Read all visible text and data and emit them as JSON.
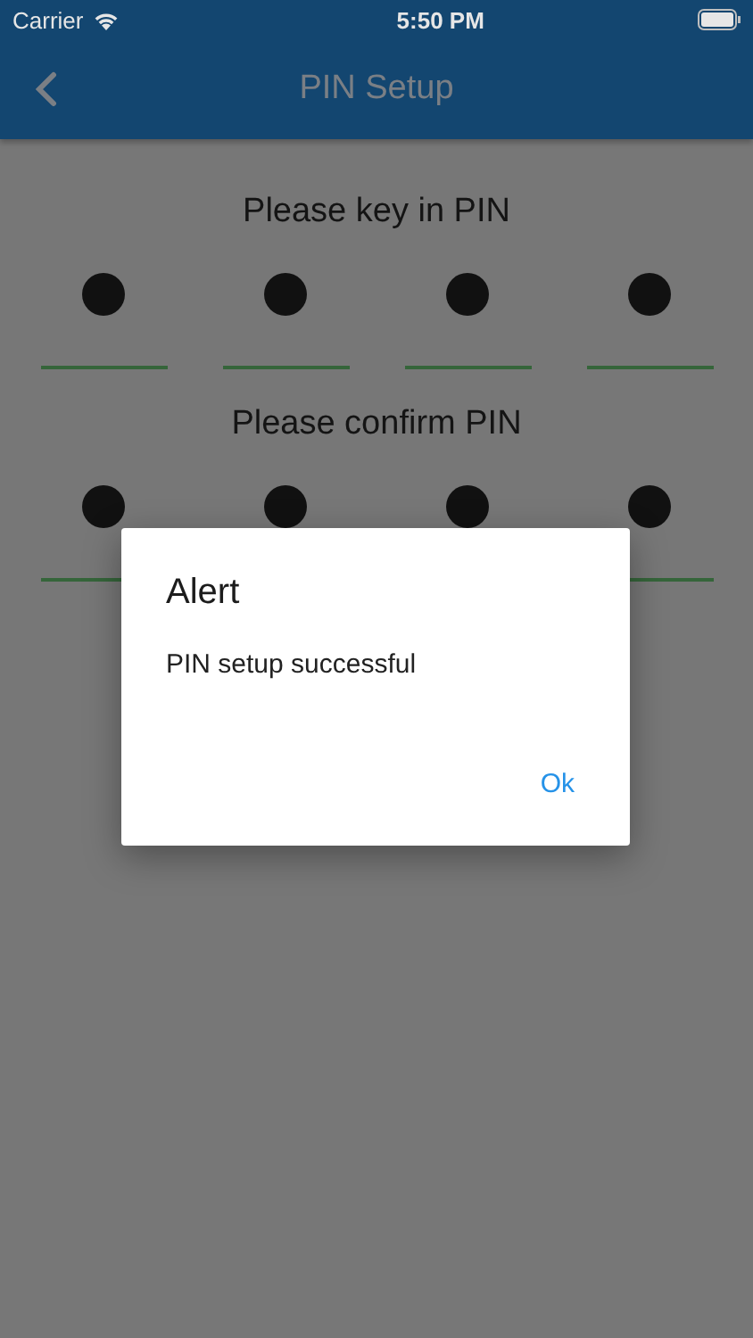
{
  "status_bar": {
    "carrier": "Carrier",
    "time": "5:50 PM"
  },
  "header": {
    "title": "PIN Setup"
  },
  "pin_groups": [
    {
      "label": "Please key in PIN",
      "digits": [
        {
          "filled": true
        },
        {
          "filled": true
        },
        {
          "filled": true
        },
        {
          "filled": true
        }
      ]
    },
    {
      "label": "Please confirm PIN",
      "digits": [
        {
          "filled": true
        },
        {
          "filled": true
        },
        {
          "filled": true
        },
        {
          "filled": true
        }
      ]
    }
  ],
  "dialog": {
    "title": "Alert",
    "message": "PIN setup successful",
    "buttons": [
      "Ok"
    ]
  }
}
